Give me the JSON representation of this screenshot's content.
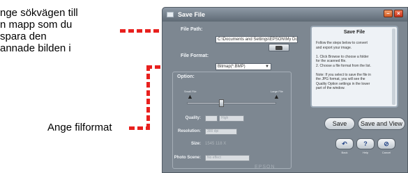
{
  "annotations": {
    "path_note": "nge sökvägen till\nn mapp som du\n spara den\nannade bilden i",
    "format_note": "Ange filformat"
  },
  "window": {
    "title": "Save File",
    "minimize_glyph": "–",
    "close_glyph": "×"
  },
  "file_path": {
    "label": "File Path:",
    "value": "C:\\Documents and Settings\\EPSON\\My Do"
  },
  "file_format": {
    "label": "File Format:",
    "selected": "Bitmap(*.BMP)"
  },
  "option": {
    "title": "Option:",
    "small_file_label": "Small File",
    "large_file_label": "Large File",
    "quality_label": "Quality:",
    "quality_value": "High",
    "resolution_label": "Resolution:",
    "resolution_value": "300 dpi",
    "size_label": "Size:",
    "size_value": "1545 118 X",
    "photo_scene_label": "Photo Scene:",
    "photo_scene_value": "No effect"
  },
  "help_panel": {
    "title": "Save File",
    "body": "Follow the steps below to convert\nand export your image.\n\n1. Click Browse to choose a folder\nfor the scanned file.\n2. Choose a file format from the list.\n\nNote: If you select to save the file in\nthe JPG format, you will see the\nQuality Option settings in the lower\npart of the window."
  },
  "buttons": {
    "save": "Save",
    "save_and_view": "Save and View",
    "back": "Back",
    "help": "Help",
    "cancel": "Cancel",
    "back_glyph": "↶",
    "help_glyph": "?",
    "cancel_glyph": "⊘"
  },
  "branding": {
    "epson": "EPSON"
  },
  "colors": {
    "annotation_leader": "#e8201e",
    "window_body": "#7d8791",
    "help_panel_bg": "#eef2f6"
  }
}
